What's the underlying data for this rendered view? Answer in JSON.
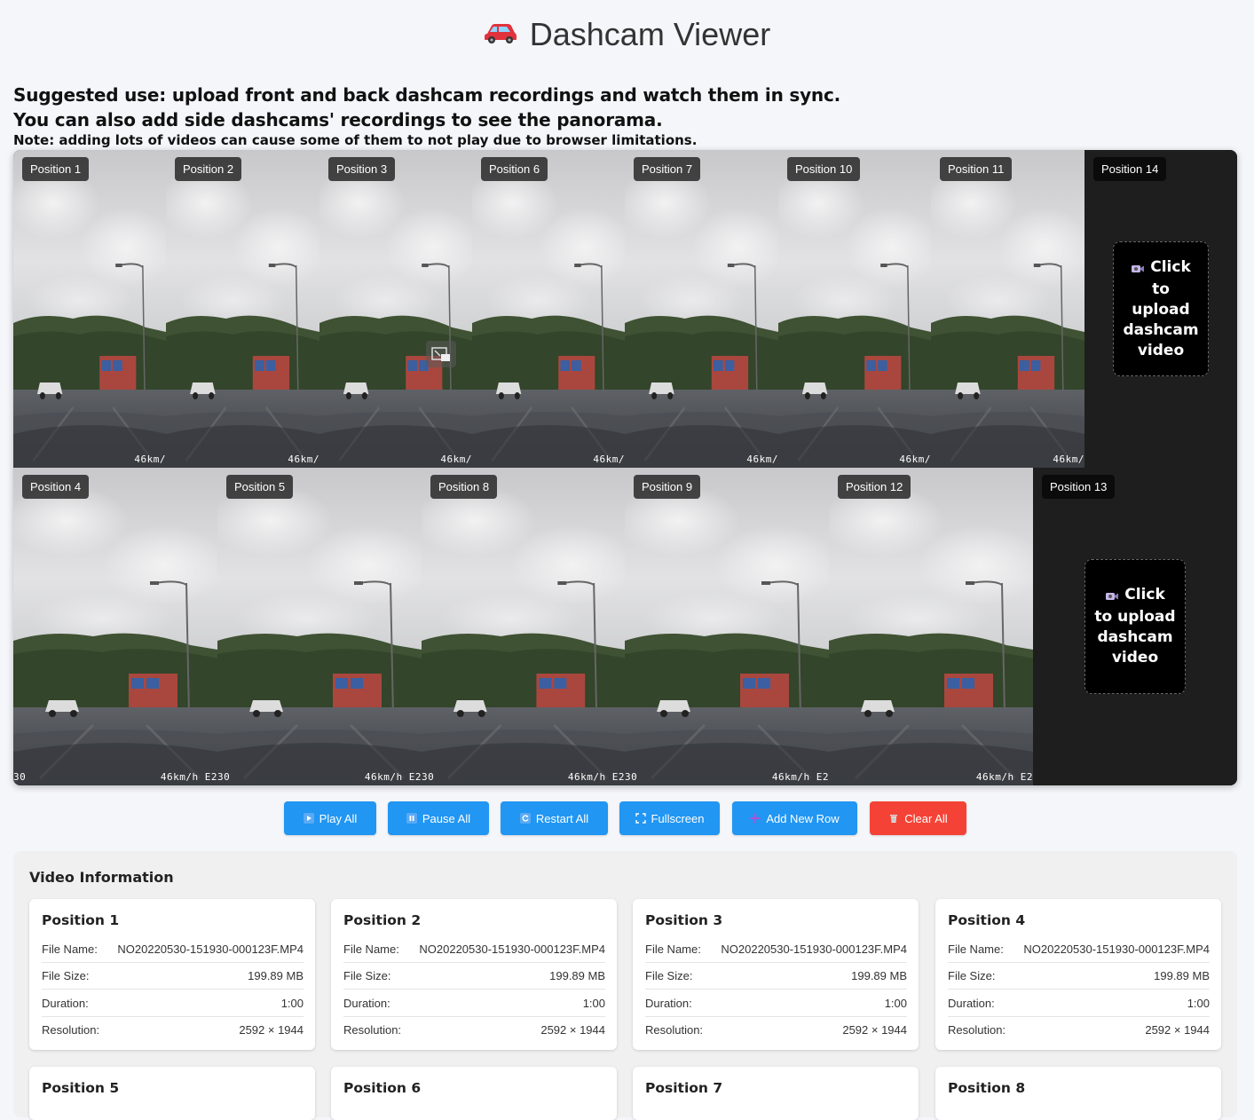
{
  "header": {
    "title": "Dashcam Viewer"
  },
  "intro": {
    "line1": "Suggested use: upload front and back dashcam recordings and watch them in sync.",
    "line2": "You can also add side dashcams' recordings to see the panorama.",
    "note": "Note: adding lots of videos can cause some of them to not play due to browser limitations."
  },
  "grid": {
    "row1": [
      "Position 1",
      "Position 2",
      "Position 3",
      "Position 6",
      "Position 7",
      "Position 10",
      "Position 11"
    ],
    "row1_empty": "Position 14",
    "row2": [
      "Position 4",
      "Position 5",
      "Position 8",
      "Position 9",
      "Position 12"
    ],
    "row2_empty": "Position 13",
    "upload_text": "Click to upload dashcam video",
    "speed_row1": "46km/",
    "speed_row2": "46km/h E2",
    "overlay_row2": "30"
  },
  "controls": {
    "play_all": "Play All",
    "pause_all": "Pause All",
    "restart_all": "Restart All",
    "fullscreen": "Fullscreen",
    "add_row": "Add New Row",
    "clear_all": "Clear All"
  },
  "info": {
    "title": "Video Information",
    "labels": {
      "file_name": "File Name:",
      "file_size": "File Size:",
      "duration": "Duration:",
      "resolution": "Resolution:"
    },
    "cards": [
      {
        "title": "Position 1",
        "file_name": "NO20220530-151930-000123F.MP4",
        "file_size": "199.89 MB",
        "duration": "1:00",
        "resolution": "2592 × 1944"
      },
      {
        "title": "Position 2",
        "file_name": "NO20220530-151930-000123F.MP4",
        "file_size": "199.89 MB",
        "duration": "1:00",
        "resolution": "2592 × 1944"
      },
      {
        "title": "Position 3",
        "file_name": "NO20220530-151930-000123F.MP4",
        "file_size": "199.89 MB",
        "duration": "1:00",
        "resolution": "2592 × 1944"
      },
      {
        "title": "Position 4",
        "file_name": "NO20220530-151930-000123F.MP4",
        "file_size": "199.89 MB",
        "duration": "1:00",
        "resolution": "2592 × 1944"
      },
      {
        "title": "Position 5"
      },
      {
        "title": "Position 6"
      },
      {
        "title": "Position 7"
      },
      {
        "title": "Position 8"
      }
    ]
  },
  "colors": {
    "accent": "#2196f3",
    "danger": "#f44336",
    "grid_bg": "#1e1e1e"
  }
}
